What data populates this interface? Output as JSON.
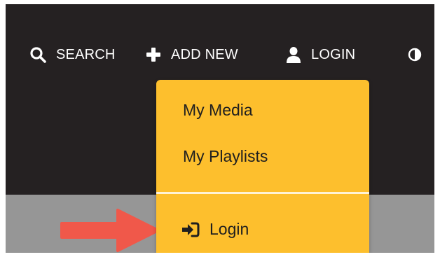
{
  "header": {
    "search_label": "SEARCH",
    "add_new_label": "ADD NEW",
    "login_label": "LOGIN",
    "icons": {
      "search": "search-icon",
      "add": "plus-icon",
      "login": "user-icon",
      "contrast": "contrast-icon"
    }
  },
  "dropdown": {
    "items": [
      {
        "label": "My Media"
      },
      {
        "label": "My Playlists"
      }
    ],
    "login_label": "Login",
    "login_icon": "sign-in-icon"
  },
  "colors": {
    "header_bg": "#252122",
    "dropdown_bg": "#fdbf2d",
    "arrow": "#f0584a",
    "page_bg": "#969696"
  }
}
